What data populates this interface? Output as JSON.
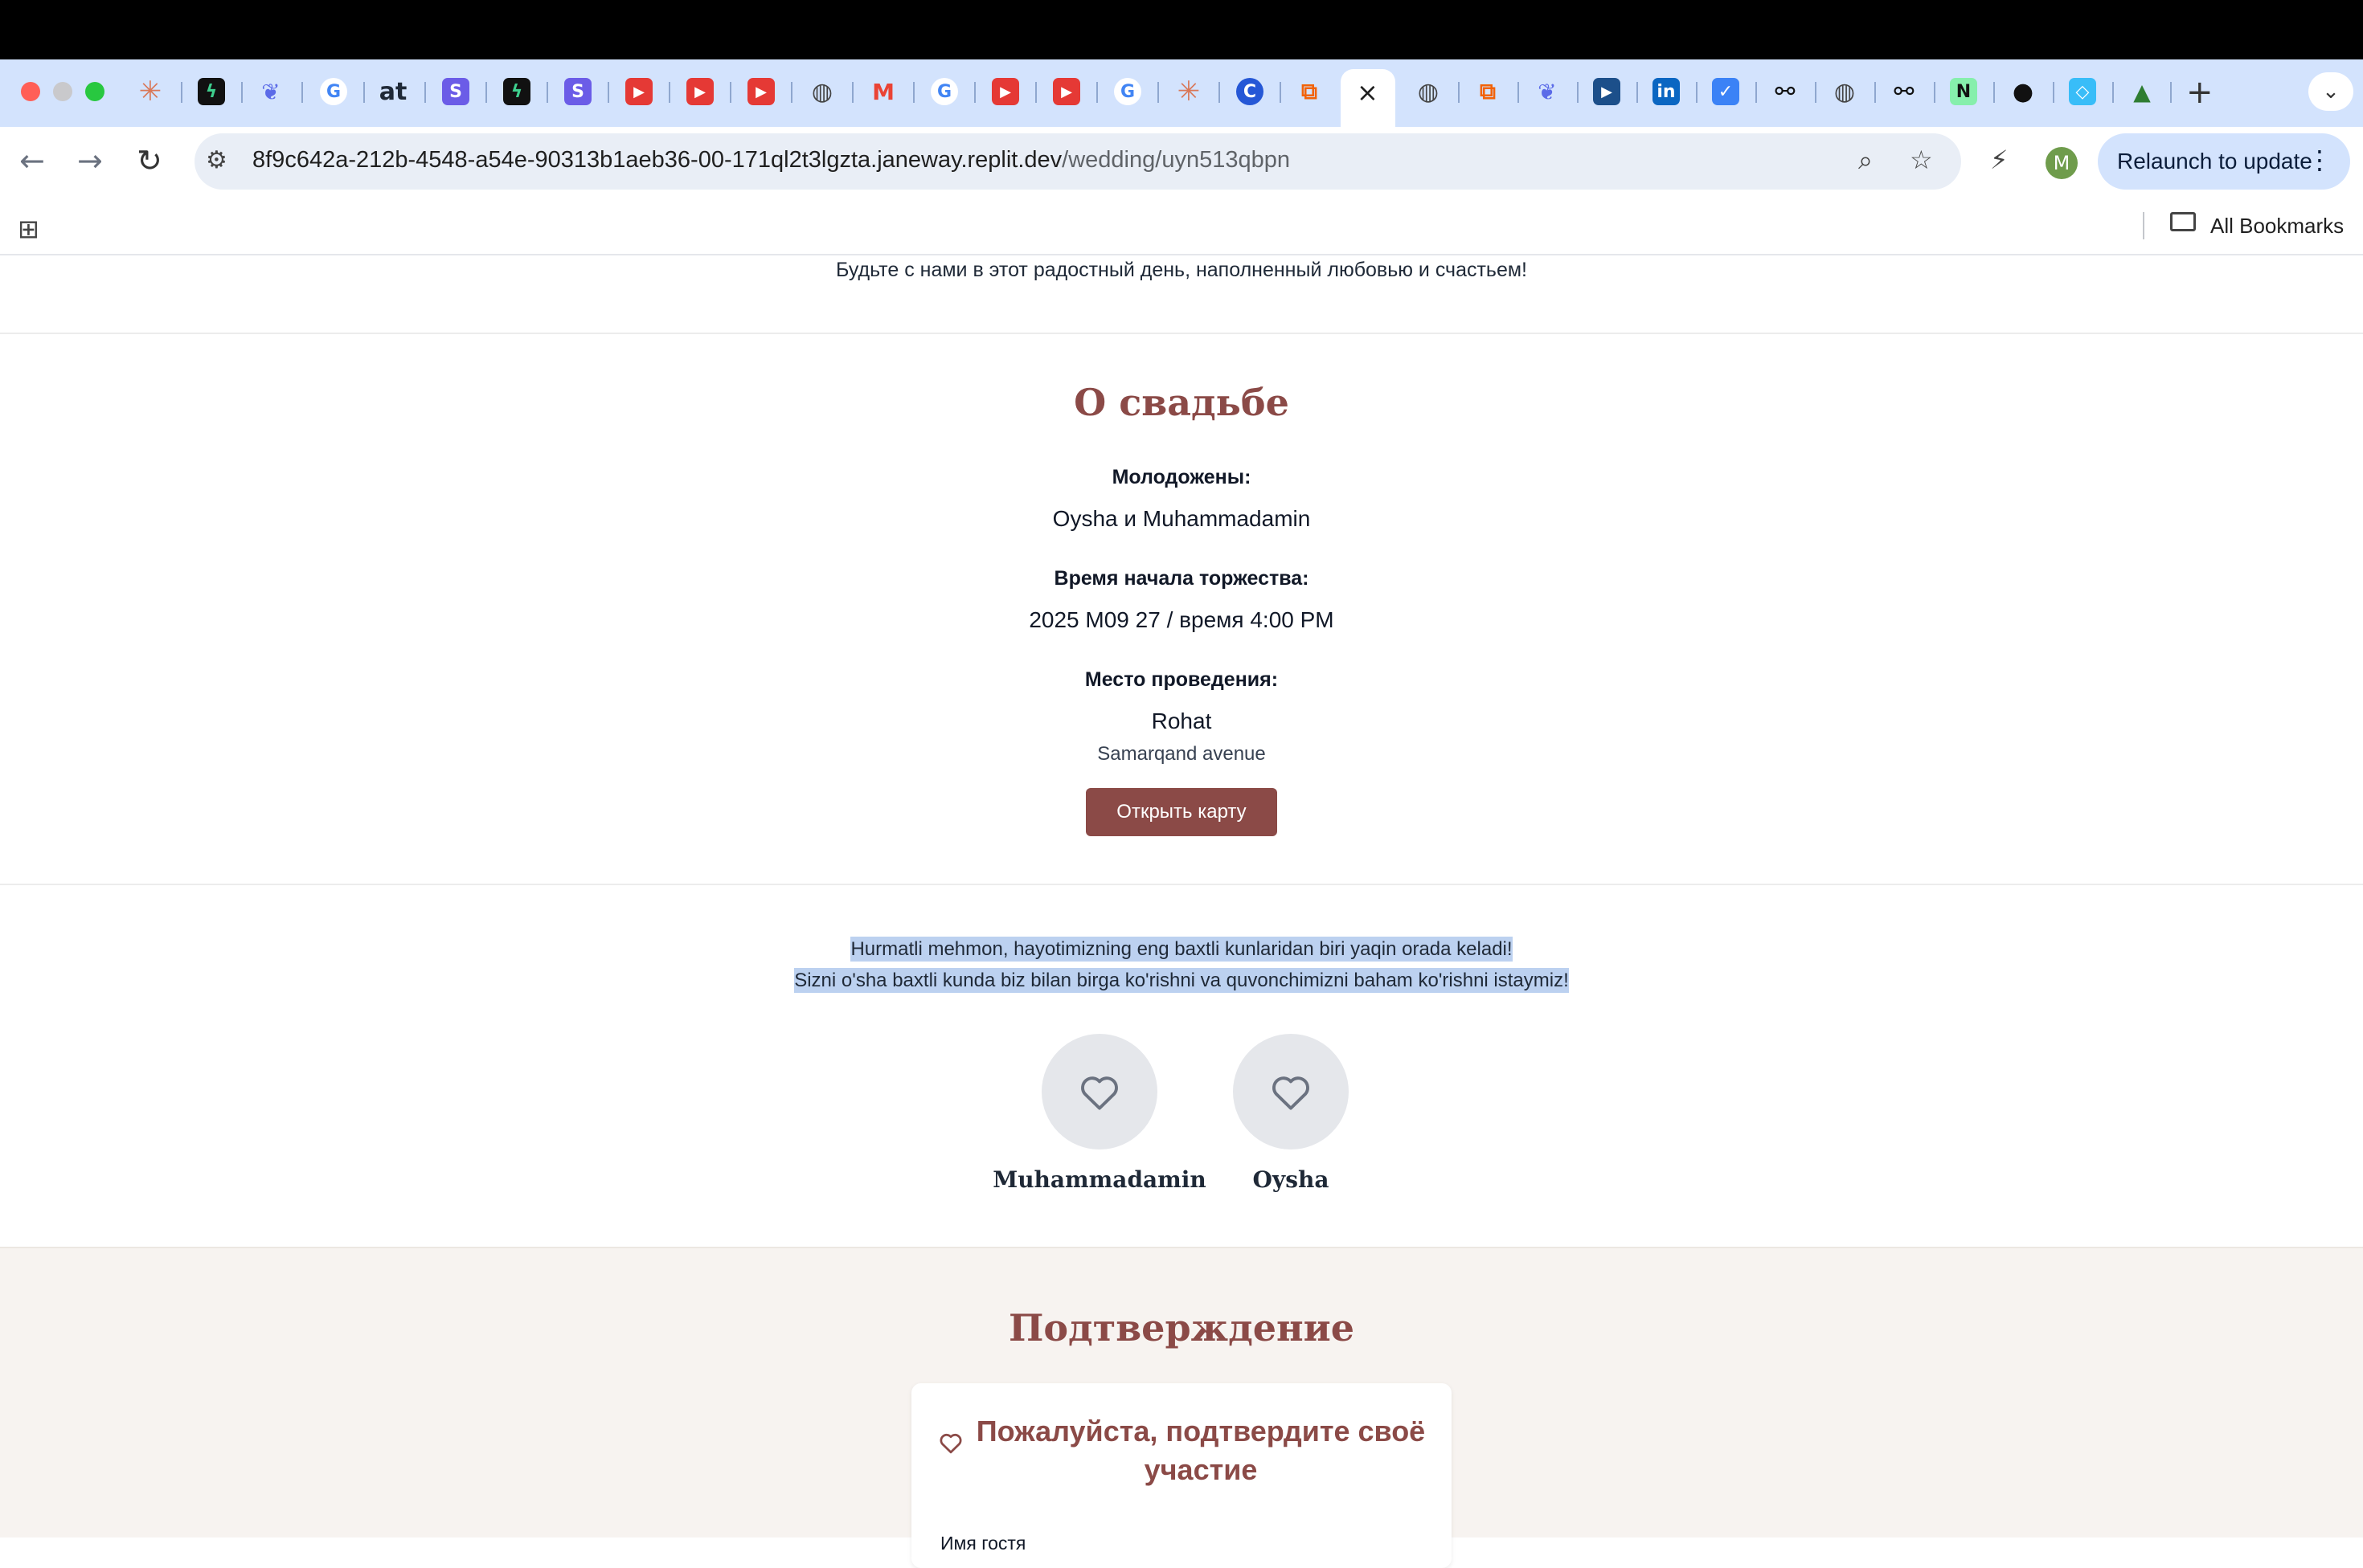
{
  "browser": {
    "active_tab_close": "×",
    "new_tab": "+",
    "tab_list": "⌄",
    "url_host": "8f9c642a-212b-4548-a54e-90313b1aeb36-00-171ql2t3lgzta.janeway.replit.dev",
    "url_path": "/wedding/uyn513qbpn",
    "profile_initial": "M",
    "relaunch_label": "Relaunch to update",
    "all_bookmarks": "All Bookmarks"
  },
  "page": {
    "intro": "Будьте с нами в этот радостный день, наполненный любовью и счастьем!",
    "about": {
      "title": "О свадьбе",
      "couple_label": "Молодожены:",
      "couple_value": "Oysha и Muhammadamin",
      "time_label": "Время начала торжества:",
      "time_value": "2025 M09 27 / время 4:00 PM",
      "venue_label": "Место проведения:",
      "venue_name": "Rohat",
      "venue_address": "Samarqand avenue",
      "map_button": "Открыть карту"
    },
    "invitation": {
      "line1": "Hurmatli mehmon, hayotimizning eng baxtli kunlaridan biri yaqin orada keladi!",
      "line2": "Sizni o'sha baxtli kunda biz bilan birga ko'rishni va quvonchimizni baham ko'rishni istaymiz!",
      "groom": "Muhammadamin",
      "bride": "Oysha"
    },
    "rsvp": {
      "title": "Подтверждение",
      "card_title": "Пожалуйста, подтвердите своё участие",
      "guest_name_label": "Имя гостя"
    }
  },
  "colors": {
    "accent": "#8b4a47",
    "rsvp_background": "#f7f3f0",
    "selection": "#bcd1f0"
  }
}
